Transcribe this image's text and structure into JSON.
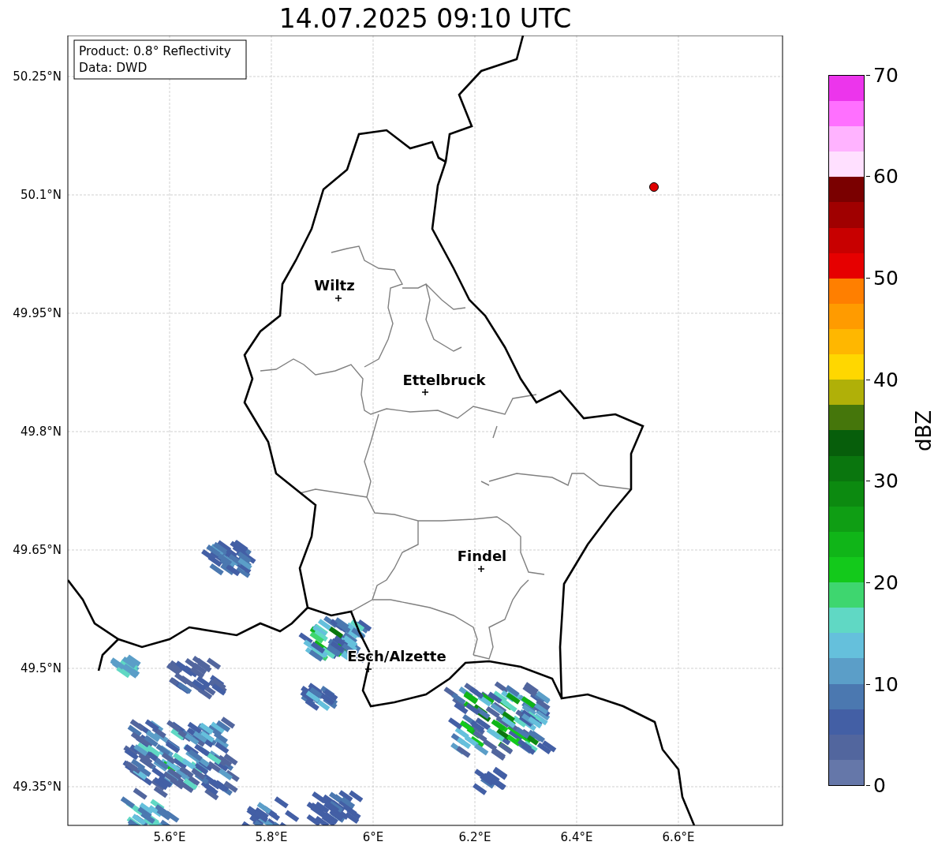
{
  "title": "14.07.2025 09:10 UTC",
  "map": {
    "info_box": [
      "Product: 0.8° Reflectivity",
      "Data: DWD"
    ],
    "x_ticks": [
      "5.6°E",
      "5.8°E",
      "6°E",
      "6.2°E",
      "6.4°E",
      "6.6°E"
    ],
    "y_ticks": [
      "50.25°N",
      "50.1°N",
      "49.95°N",
      "49.8°N",
      "49.65°N",
      "49.5°N",
      "49.35°N"
    ],
    "cities": [
      {
        "name": "Wiltz"
      },
      {
        "name": "Ettelbruck"
      },
      {
        "name": "Findel"
      },
      {
        "name": "Esch/Alzette"
      }
    ]
  },
  "colorbar": {
    "label": "dBZ",
    "ticks": [
      "70",
      "60",
      "50",
      "40",
      "30",
      "20",
      "10",
      "0"
    ],
    "bins": [
      {
        "color": "#6577a9"
      },
      {
        "color": "#52669e"
      },
      {
        "color": "#435fa5"
      },
      {
        "color": "#4b78b0"
      },
      {
        "color": "#5b9ec8"
      },
      {
        "color": "#65c0dc"
      },
      {
        "color": "#60d8c4"
      },
      {
        "color": "#3ed66f"
      },
      {
        "color": "#13c91b"
      },
      {
        "color": "#10b518"
      },
      {
        "color": "#0f9e14"
      },
      {
        "color": "#0c8a10"
      },
      {
        "color": "#0a760e"
      },
      {
        "color": "#075e0b"
      },
      {
        "color": "#45760b"
      },
      {
        "color": "#b0b008"
      },
      {
        "color": "#ffd700"
      },
      {
        "color": "#ffb700"
      },
      {
        "color": "#ff9b00"
      },
      {
        "color": "#ff7f00"
      },
      {
        "color": "#e60000"
      },
      {
        "color": "#c80000"
      },
      {
        "color": "#a00000"
      },
      {
        "color": "#7a0000"
      },
      {
        "color": "#ffe0ff"
      },
      {
        "color": "#ffb3ff"
      },
      {
        "color": "#ff70ff"
      },
      {
        "color": "#ec35ec"
      }
    ]
  }
}
